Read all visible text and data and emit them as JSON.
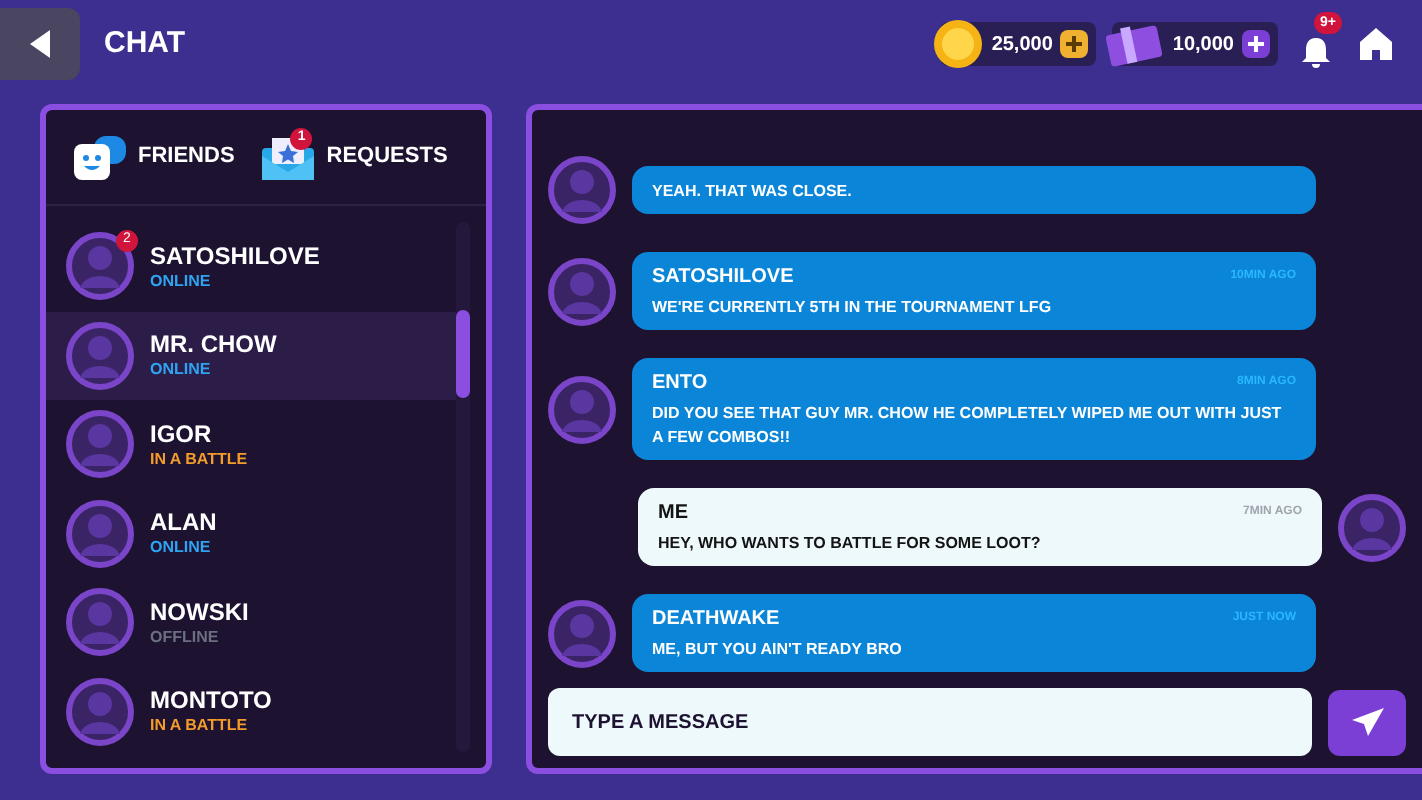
{
  "header": {
    "title": "CHAT",
    "coins": "25,000",
    "gems": "10,000",
    "notifications_badge": "9+"
  },
  "friends_panel": {
    "tabs": [
      {
        "label": "FRIENDS"
      },
      {
        "label": "REQUESTS",
        "badge": "1"
      }
    ],
    "friends": [
      {
        "name": "SATOSHILOVE",
        "status": "ONLINE",
        "color": "#2ea3f2",
        "selected": false,
        "badge": "2"
      },
      {
        "name": "MR. CHOW",
        "status": "ONLINE",
        "color": "#2ea3f2",
        "selected": true
      },
      {
        "name": "IGOR",
        "status": "IN A BATTLE",
        "color": "#f39c2b",
        "selected": false
      },
      {
        "name": "ALAN",
        "status": "ONLINE",
        "color": "#2ea3f2",
        "selected": false
      },
      {
        "name": "NOWSKI",
        "status": "OFFLINE",
        "color": "#6b6f80",
        "selected": false
      },
      {
        "name": "MONTOTO",
        "status": "IN A BATTLE",
        "color": "#f39c2b",
        "selected": false
      }
    ]
  },
  "messages": [
    {
      "kind": "other",
      "text": "YEAH. THAT WAS CLOSE."
    },
    {
      "kind": "other",
      "sender": "SATOSHILOVE",
      "time": "10MIN AGO",
      "text": "WE'RE CURRENTLY 5TH IN THE TOURNAMENT LFG"
    },
    {
      "kind": "other",
      "sender": "ENTO",
      "time": "8MIN AGO",
      "text": "DID YOU SEE THAT GUY MR. CHOW HE COMPLETELY WIPED ME OUT WITH JUST A FEW COMBOS!!"
    },
    {
      "kind": "me",
      "sender": "ME",
      "time": "7MIN AGO",
      "text": "HEY, WHO WANTS TO BATTLE FOR SOME LOOT?"
    },
    {
      "kind": "other",
      "sender": "DEATHWAKE",
      "time": "JUST NOW",
      "text": "ME, BUT YOU AIN'T READY BRO"
    }
  ],
  "composer": {
    "placeholder": "TYPE A MESSAGE"
  }
}
